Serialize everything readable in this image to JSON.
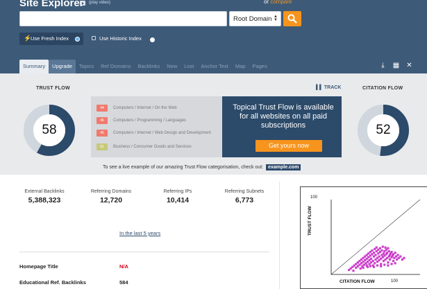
{
  "header": {
    "title": "Site Explorer",
    "play_video": "(play video)",
    "or_text": "or",
    "compare_link": "compare",
    "search_placeholder": "",
    "domain_select": "Root Domain",
    "fresh_index": "Use Fresh Index",
    "historic_index": "Use Historic Index"
  },
  "tabs": [
    {
      "label": "Summary"
    },
    {
      "label": "Upgrade"
    },
    {
      "label": "Topics"
    },
    {
      "label": "Ref Domains"
    },
    {
      "label": "Backlinks"
    },
    {
      "label": "New"
    },
    {
      "label": "Lost"
    },
    {
      "label": "Anchor Text"
    },
    {
      "label": "Map"
    },
    {
      "label": "Pages"
    }
  ],
  "tool_icons": [
    "download-icon",
    "spreadsheet-icon",
    "tools-icon"
  ],
  "metrics": {
    "trust_flow_label": "TRUST FLOW",
    "trust_flow": 58,
    "citation_flow_label": "CITATION FLOW",
    "citation_flow": 52,
    "track_label": "TRACK"
  },
  "promo": {
    "topics": [
      {
        "score": "44",
        "text": "Computers / Internet / On the Web",
        "color": "#f07a6e"
      },
      {
        "score": "46",
        "text": "Computers / Programming / Languages",
        "color": "#f07a6e"
      },
      {
        "score": "45",
        "text": "Computers / Internet / Web Design and Development",
        "color": "#f07a6e"
      },
      {
        "score": "61",
        "text": "Business / Consumer Goods and Services",
        "color": "#c7c97a"
      }
    ],
    "headline": "Topical Trust Flow is available for all websites on all paid subscriptions",
    "cta": "Get yours now",
    "example_text": "To see a live example of our amazing Trust Flow categorisation, check out:",
    "example_link": "example.com"
  },
  "stats": [
    {
      "label": "External Backlinks",
      "value": "5,388,323"
    },
    {
      "label": "Referring Domains",
      "value": "12,720"
    },
    {
      "label": "Referring IPs",
      "value": "10,414"
    },
    {
      "label": "Referring Subnets",
      "value": "6,773"
    }
  ],
  "last_5_years": "In the last 5 years",
  "rows": [
    {
      "label": "Homepage Title",
      "value": "N/A",
      "color": "#d0021b"
    },
    {
      "label": "Educational Ref. Backlinks",
      "value": "584",
      "color": "#222222"
    }
  ],
  "chart_data": {
    "type": "scatter",
    "xlabel": "CITATION FLOW",
    "ylabel": "TRUST FLOW",
    "xlim": [
      0,
      100
    ],
    "ylim": [
      0,
      100
    ],
    "tick_labels": {
      "x_max": "100",
      "y_max": "100"
    },
    "point_color": "#c21fc2",
    "diagonal": true,
    "points": [
      [
        20,
        6
      ],
      [
        22,
        8
      ],
      [
        24,
        10
      ],
      [
        25,
        5
      ],
      [
        26,
        12
      ],
      [
        28,
        9
      ],
      [
        28,
        14
      ],
      [
        30,
        11
      ],
      [
        30,
        16
      ],
      [
        32,
        13
      ],
      [
        32,
        18
      ],
      [
        33,
        8
      ],
      [
        34,
        15
      ],
      [
        34,
        20
      ],
      [
        35,
        11
      ],
      [
        36,
        17
      ],
      [
        36,
        22
      ],
      [
        37,
        13
      ],
      [
        38,
        19
      ],
      [
        38,
        24
      ],
      [
        39,
        15
      ],
      [
        40,
        21
      ],
      [
        40,
        26
      ],
      [
        41,
        10
      ],
      [
        41,
        17
      ],
      [
        42,
        23
      ],
      [
        42,
        28
      ],
      [
        43,
        14
      ],
      [
        43,
        19
      ],
      [
        44,
        25
      ],
      [
        44,
        30
      ],
      [
        45,
        16
      ],
      [
        45,
        21
      ],
      [
        46,
        27
      ],
      [
        46,
        32
      ],
      [
        47,
        12
      ],
      [
        47,
        18
      ],
      [
        48,
        24
      ],
      [
        48,
        29
      ],
      [
        49,
        34
      ],
      [
        49,
        15
      ],
      [
        50,
        20
      ],
      [
        50,
        26
      ],
      [
        51,
        31
      ],
      [
        51,
        36
      ],
      [
        52,
        17
      ],
      [
        52,
        22
      ],
      [
        53,
        28
      ],
      [
        53,
        33
      ],
      [
        54,
        19
      ],
      [
        54,
        24
      ],
      [
        55,
        30
      ],
      [
        55,
        35
      ],
      [
        56,
        14
      ],
      [
        56,
        21
      ],
      [
        57,
        26
      ],
      [
        57,
        32
      ],
      [
        58,
        37
      ],
      [
        58,
        23
      ],
      [
        59,
        28
      ],
      [
        59,
        18
      ],
      [
        60,
        25
      ],
      [
        60,
        31
      ],
      [
        61,
        36
      ],
      [
        61,
        20
      ],
      [
        62,
        27
      ],
      [
        62,
        33
      ],
      [
        63,
        22
      ],
      [
        63,
        29
      ],
      [
        64,
        35
      ],
      [
        64,
        16
      ],
      [
        65,
        24
      ],
      [
        65,
        31
      ],
      [
        66,
        26
      ],
      [
        66,
        20
      ],
      [
        67,
        28
      ],
      [
        68,
        23
      ],
      [
        68,
        30
      ],
      [
        69,
        25
      ],
      [
        70,
        18
      ],
      [
        70,
        27
      ],
      [
        71,
        22
      ],
      [
        72,
        29
      ],
      [
        73,
        24
      ],
      [
        74,
        20
      ],
      [
        75,
        26
      ],
      [
        76,
        22
      ],
      [
        78,
        24
      ],
      [
        80,
        20
      ],
      [
        82,
        22
      ],
      [
        36,
        9
      ],
      [
        40,
        12
      ],
      [
        44,
        11
      ],
      [
        48,
        10
      ],
      [
        52,
        12
      ],
      [
        56,
        11
      ],
      [
        60,
        13
      ],
      [
        64,
        12
      ],
      [
        68,
        14
      ],
      [
        72,
        15
      ]
    ]
  }
}
